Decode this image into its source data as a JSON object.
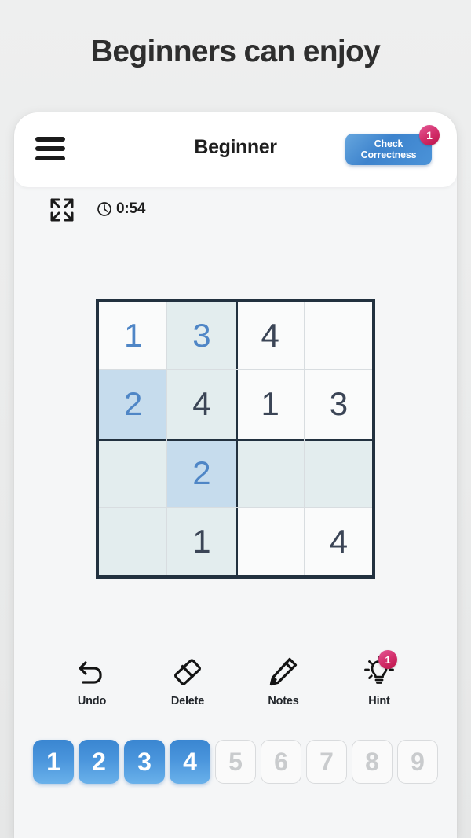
{
  "headline": "Beginners can enjoy",
  "appbar": {
    "menu_icon": "hamburger-menu-icon",
    "title": "Beginner",
    "check_button": {
      "line1": "Check",
      "line2": "Correctness",
      "badge": "1"
    }
  },
  "subbar": {
    "expand_icon": "fullscreen-expand-icon",
    "clock_icon": "clock-icon",
    "time": "0:54"
  },
  "board": {
    "size": 4,
    "cells": [
      {
        "value": "1",
        "state": "user",
        "bg": "plain"
      },
      {
        "value": "3",
        "state": "user",
        "bg": "tint"
      },
      {
        "value": "4",
        "state": "given",
        "bg": "plain"
      },
      {
        "value": "",
        "state": "empty",
        "bg": "plain"
      },
      {
        "value": "2",
        "state": "user",
        "bg": "sel"
      },
      {
        "value": "4",
        "state": "given",
        "bg": "tint"
      },
      {
        "value": "1",
        "state": "given",
        "bg": "plain"
      },
      {
        "value": "3",
        "state": "given",
        "bg": "plain"
      },
      {
        "value": "",
        "state": "empty",
        "bg": "tint"
      },
      {
        "value": "2",
        "state": "user",
        "bg": "sel"
      },
      {
        "value": "",
        "state": "empty",
        "bg": "tint"
      },
      {
        "value": "",
        "state": "empty",
        "bg": "tint"
      },
      {
        "value": "",
        "state": "empty",
        "bg": "tint"
      },
      {
        "value": "1",
        "state": "given",
        "bg": "tint"
      },
      {
        "value": "",
        "state": "empty",
        "bg": "plain"
      },
      {
        "value": "4",
        "state": "given",
        "bg": "plain"
      }
    ]
  },
  "tools": [
    {
      "label": "Undo",
      "icon": "undo-arrow-icon",
      "badge": ""
    },
    {
      "label": "Delete",
      "icon": "eraser-icon",
      "badge": ""
    },
    {
      "label": "Notes",
      "icon": "pencil-icon",
      "badge": ""
    },
    {
      "label": "Hint",
      "icon": "lightbulb-icon",
      "badge": "1"
    }
  ],
  "numpad": [
    {
      "label": "1",
      "enabled": true
    },
    {
      "label": "2",
      "enabled": true
    },
    {
      "label": "3",
      "enabled": true
    },
    {
      "label": "4",
      "enabled": true
    },
    {
      "label": "5",
      "enabled": false
    },
    {
      "label": "6",
      "enabled": false
    },
    {
      "label": "7",
      "enabled": false
    },
    {
      "label": "8",
      "enabled": false
    },
    {
      "label": "9",
      "enabled": false
    }
  ],
  "colors": {
    "page_bg": "#ececed",
    "card_bg": "#f5f6f7",
    "accent_blue": "#4a8fd6",
    "badge_pink": "#cf2a63",
    "grid_border": "#22313f",
    "given_number": "#3b4556",
    "user_number": "#4f86c6",
    "cell_tint": "#e3edee",
    "cell_selected": "#c6dced"
  }
}
